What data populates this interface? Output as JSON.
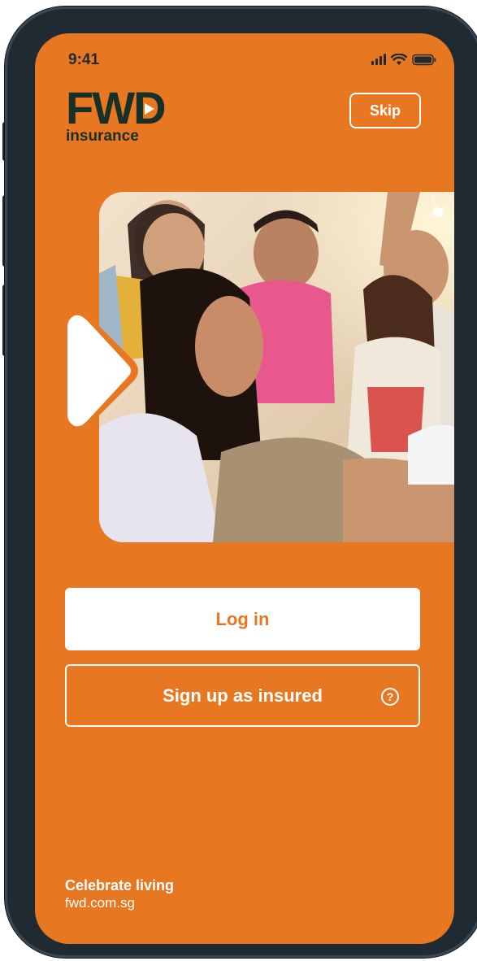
{
  "status_bar": {
    "time": "9:41",
    "icons": [
      "signal-icon",
      "wifi-icon",
      "battery-icon"
    ]
  },
  "brand": {
    "logo_word": "FW",
    "logo_letter_d": "D",
    "logo_sub": "insurance",
    "colors": {
      "primary": "#E87722",
      "logo_dark": "#183028",
      "white": "#FFFFFF"
    }
  },
  "header": {
    "skip_label": "Skip"
  },
  "hero": {
    "image": "group-of-friends-celebrating-with-sparklers"
  },
  "actions": {
    "login_label": "Log in",
    "signup_label": "Sign up as insured",
    "help_glyph": "?"
  },
  "footer": {
    "tagline": "Celebrate living",
    "url": "fwd.com.sg"
  }
}
